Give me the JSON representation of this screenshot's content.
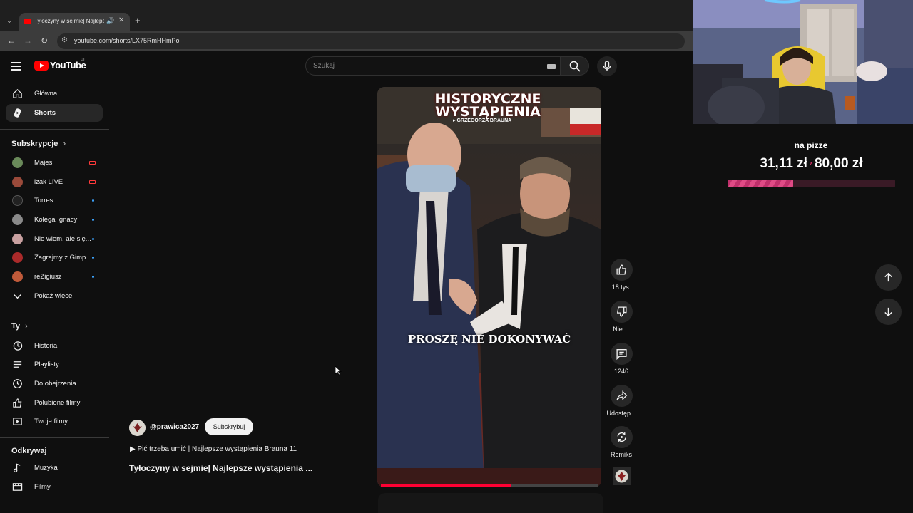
{
  "browser": {
    "tab_title": "Tyłoczyny w sejmie| Najlepsze wystąpienia",
    "url": "youtube.com/shorts/LX75RmHHmPo"
  },
  "header": {
    "logo_text": "YouTube",
    "country": "PL",
    "search_placeholder": "Szukaj"
  },
  "sidebar": {
    "main": [
      {
        "label": "Główna",
        "icon": "home-icon"
      },
      {
        "label": "Shorts",
        "icon": "shorts-icon",
        "active": true
      }
    ],
    "subs_heading": "Subskrypcje",
    "subscriptions": [
      {
        "label": "Majes",
        "badge": "live",
        "color": "#6a8a5a"
      },
      {
        "label": "izak LIVE",
        "badge": "live",
        "color": "#9a4a3a"
      },
      {
        "label": "Torres",
        "badge": "new",
        "color": "#222222"
      },
      {
        "label": "Kolega Ignacy",
        "badge": "new",
        "color": "#8a8a8a"
      },
      {
        "label": "Nie wiem, ale się...",
        "badge": "new",
        "color": "#c8a0a0"
      },
      {
        "label": "Zagrajmy z Gimp...",
        "badge": "new",
        "color": "#aa2a2a"
      },
      {
        "label": "reZigiusz",
        "badge": "new",
        "color": "#c05a3a"
      }
    ],
    "show_more": "Pokaż więcej",
    "you_heading": "Ty",
    "you_items": [
      {
        "label": "Historia",
        "icon": "history-icon"
      },
      {
        "label": "Playlisty",
        "icon": "playlist-icon"
      },
      {
        "label": "Do obejrzenia",
        "icon": "clock-icon"
      },
      {
        "label": "Polubione filmy",
        "icon": "like-icon"
      },
      {
        "label": "Twoje filmy",
        "icon": "video-icon"
      }
    ],
    "explore_heading": "Odkrywaj",
    "explore_items": [
      {
        "label": "Muzyka",
        "icon": "music-icon"
      },
      {
        "label": "Filmy",
        "icon": "film-icon"
      }
    ]
  },
  "short": {
    "overlay_title_line1": "HISTORYCZNE",
    "overlay_title_line2": "WYSTĄPIENIA",
    "overlay_subtitle": "▸ GRZEGORZA BRAUNA",
    "caption": "PROSZĘ NIE DOKONYWAĆ",
    "progress": 0.6,
    "channel": "@prawica2027",
    "subscribe_label": "Subskrybuj",
    "music": "▶  Pić trzeba umić | Najlepsze wystąpienia Brauna 11",
    "title": "Tyłoczyny w sejmie| Najlepsze wystąpienia ..."
  },
  "actions": {
    "likes": "18 tys.",
    "dislike": "Nie ...",
    "comments": "1246",
    "share": "Udostęp...",
    "remix": "Remiks"
  },
  "donation": {
    "label": "na pizze",
    "current": "31,11 zł",
    "separator": "z",
    "goal": "80,00 zł",
    "progress": 0.39,
    "accent": "#e0306b"
  }
}
